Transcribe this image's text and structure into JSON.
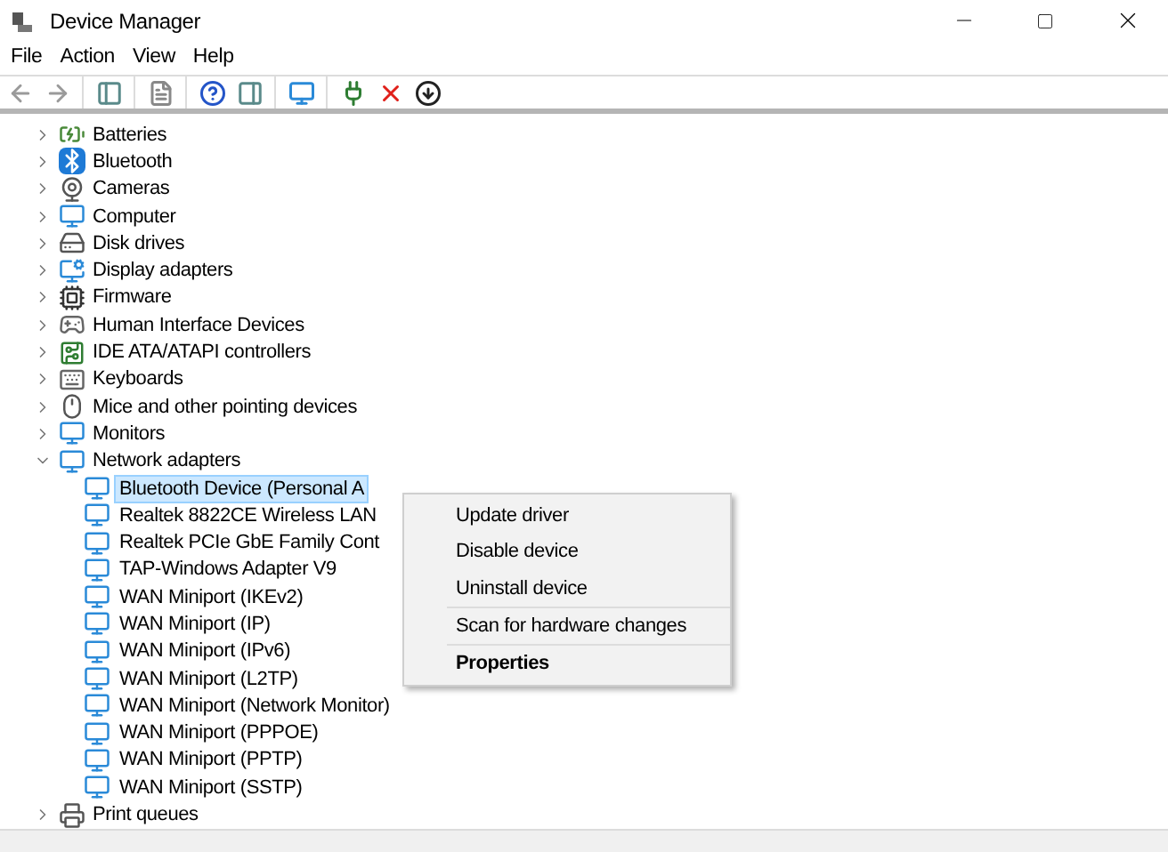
{
  "window": {
    "title": "Device Manager"
  },
  "menu_bar": [
    "File",
    "Action",
    "View",
    "Help"
  ],
  "tree": [
    {
      "label": "Batteries",
      "kind": "battery",
      "expanded": false
    },
    {
      "label": "Bluetooth",
      "kind": "bluetooth",
      "expanded": false
    },
    {
      "label": "Cameras",
      "kind": "camera",
      "expanded": false
    },
    {
      "label": "Computer",
      "kind": "computer",
      "expanded": false
    },
    {
      "label": "Disk drives",
      "kind": "disk",
      "expanded": false
    },
    {
      "label": "Display adapters",
      "kind": "display",
      "expanded": false
    },
    {
      "label": "Firmware",
      "kind": "chip",
      "expanded": false
    },
    {
      "label": "Human Interface Devices",
      "kind": "hid",
      "expanded": false
    },
    {
      "label": "IDE ATA/ATAPI controllers",
      "kind": "ide",
      "expanded": false
    },
    {
      "label": "Keyboards",
      "kind": "keyboard",
      "expanded": false
    },
    {
      "label": "Mice and other pointing devices",
      "kind": "mouse",
      "expanded": false
    },
    {
      "label": "Monitors",
      "kind": "computer",
      "expanded": false
    },
    {
      "label": "Network adapters",
      "kind": "network",
      "expanded": true,
      "children": [
        {
          "label": "Bluetooth Device (Personal A",
          "selected": true
        },
        {
          "label": "Realtek 8822CE Wireless LAN",
          "selected": false
        },
        {
          "label": "Realtek PCIe GbE Family Cont",
          "selected": false
        },
        {
          "label": "TAP-Windows Adapter V9",
          "selected": false
        },
        {
          "label": "WAN Miniport (IKEv2)",
          "selected": false
        },
        {
          "label": "WAN Miniport (IP)",
          "selected": false
        },
        {
          "label": "WAN Miniport (IPv6)",
          "selected": false
        },
        {
          "label": "WAN Miniport (L2TP)",
          "selected": false
        },
        {
          "label": "WAN Miniport (Network Monitor)",
          "selected": false
        },
        {
          "label": "WAN Miniport (PPPOE)",
          "selected": false
        },
        {
          "label": "WAN Miniport (PPTP)",
          "selected": false
        },
        {
          "label": "WAN Miniport (SSTP)",
          "selected": false
        }
      ]
    },
    {
      "label": "Print queues",
      "kind": "printer",
      "expanded": false
    }
  ],
  "context_menu": {
    "groups": [
      [
        {
          "label": "Update driver",
          "default": false
        },
        {
          "label": "Disable device",
          "default": false
        },
        {
          "label": "Uninstall device",
          "default": false
        }
      ],
      [
        {
          "label": "Scan for hardware changes",
          "default": false
        }
      ],
      [
        {
          "label": "Properties",
          "default": true
        }
      ]
    ]
  }
}
